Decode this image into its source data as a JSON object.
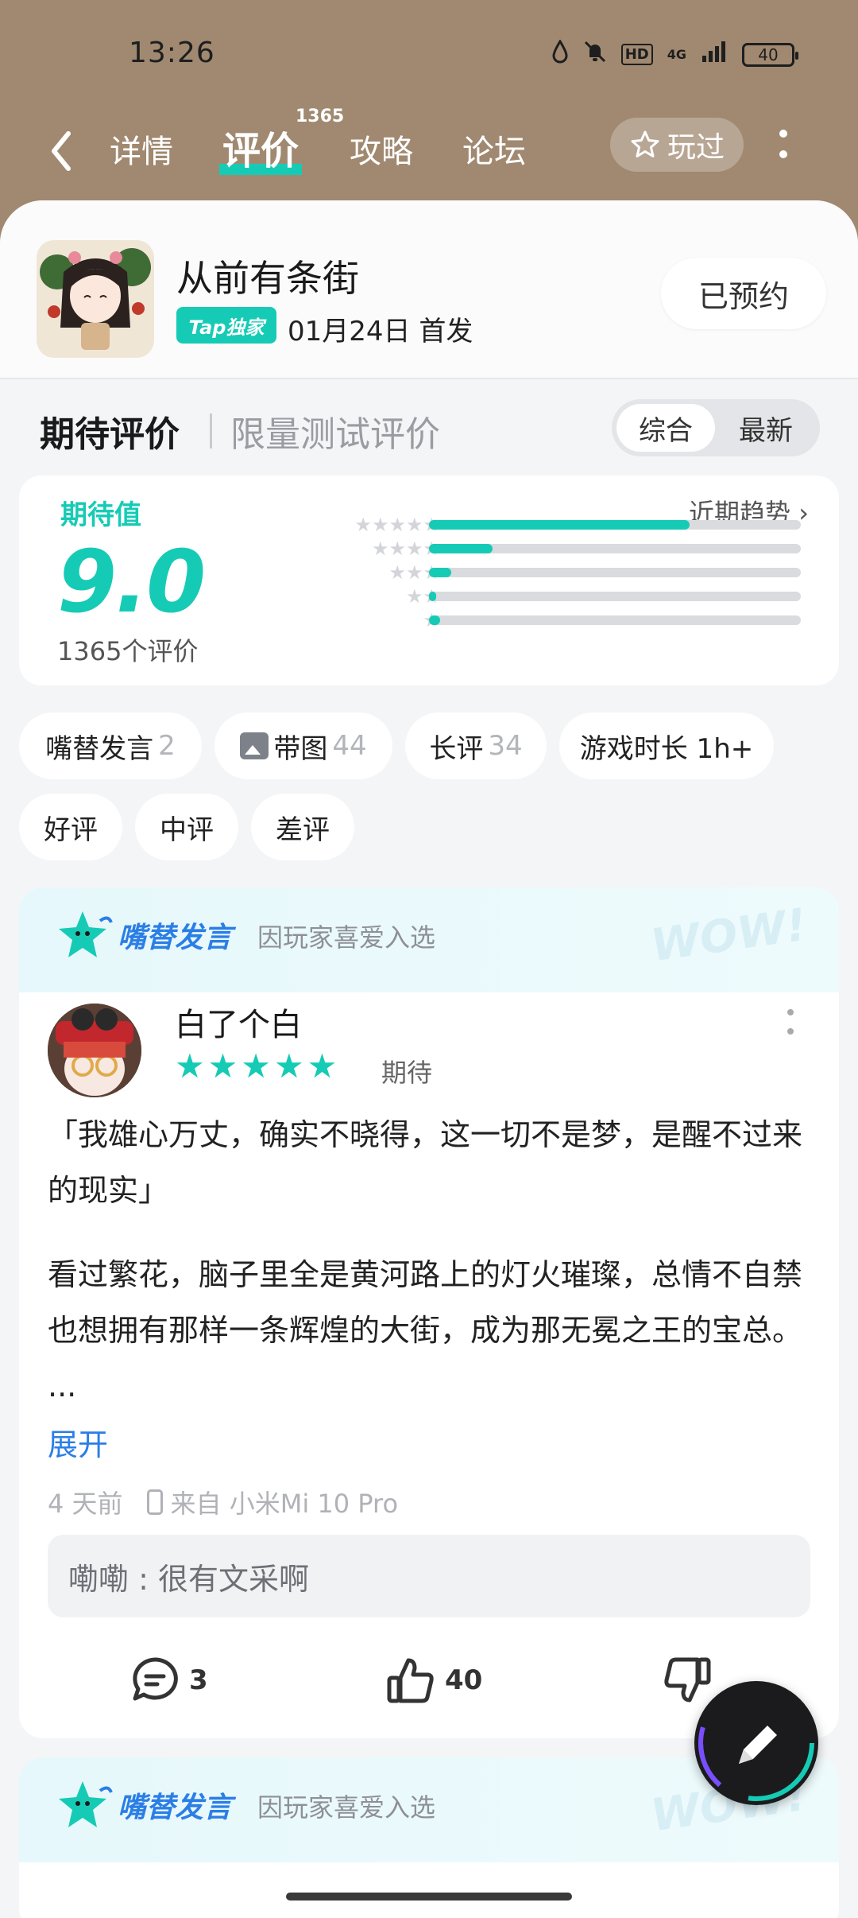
{
  "status_bar": {
    "time": "13:26",
    "hd": "HD",
    "network": "4G",
    "battery": "40"
  },
  "nav": {
    "tabs": [
      {
        "label": "详情"
      },
      {
        "label": "评价"
      },
      {
        "label": "攻略"
      },
      {
        "label": "论坛"
      }
    ],
    "active_badge": "1365",
    "played_label": "玩过"
  },
  "game": {
    "title": "从前有条街",
    "tap_badge": "Tap独家",
    "release": "01月24日 首发",
    "reserve_label": "已预约"
  },
  "rating_header": {
    "title": "期待评价",
    "subtitle": "限量测试评价",
    "sort_options": [
      "综合",
      "最新"
    ],
    "selected_sort": "综合"
  },
  "score": {
    "label": "期待值",
    "value": "9.0",
    "count": "1365个评价",
    "trend": "近期趋势 ›",
    "distribution": [
      {
        "stars": 5,
        "fraction": 0.7
      },
      {
        "stars": 4,
        "fraction": 0.17
      },
      {
        "stars": 3,
        "fraction": 0.06
      },
      {
        "stars": 2,
        "fraction": 0.02
      },
      {
        "stars": 1,
        "fraction": 0.03
      }
    ]
  },
  "filters": [
    {
      "label": "嘴替发言",
      "count": "2"
    },
    {
      "label": "带图",
      "count": "44"
    },
    {
      "label": "长评",
      "count": "34"
    },
    {
      "label": "游戏时长 1h+",
      "count": ""
    },
    {
      "label": "好评",
      "count": ""
    },
    {
      "label": "中评",
      "count": ""
    },
    {
      "label": "差评",
      "count": ""
    }
  ],
  "reviews": [
    {
      "brand": "嘴替发言",
      "reason": "因玩家喜爱入选",
      "wow": "WOW!",
      "user": "白了个白",
      "stars": "★★★★★",
      "attitude": "期待",
      "quote": "「我雄心万丈，确实不晓得，这一切不是梦，是醒不过来的现实」",
      "body": "看过繁花，脑子里全是黄河路上的灯火璀璨，总情不自禁也想拥有那样一条辉煌的大街，成为那无冕之王的宝总。 ...",
      "expand": "展开",
      "time": "4 天前",
      "device": "来自 小米Mi 10 Pro",
      "reply": "嘞嘞 : 很有文采啊",
      "comments": "3",
      "likes": "40"
    },
    {
      "brand": "嘴替发言",
      "reason": "因玩家喜爱入选",
      "wow": "WOW!"
    }
  ],
  "colors": {
    "accent": "#16cbb5",
    "link": "#2b7ee6",
    "header_bg": "#a08970"
  }
}
